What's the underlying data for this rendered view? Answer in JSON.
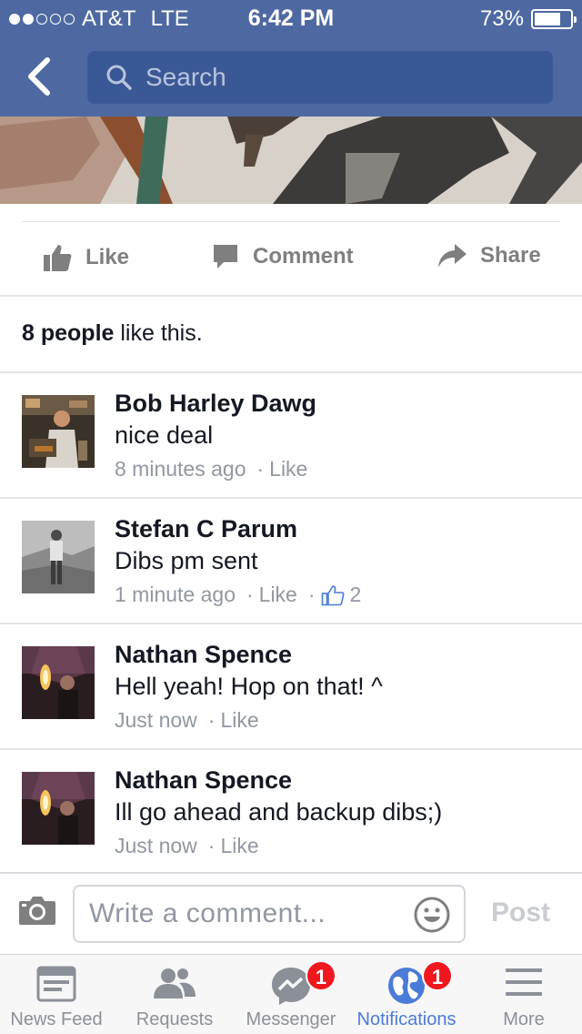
{
  "status_bar": {
    "carrier": "AT&T",
    "network": "LTE",
    "time": "6:42 PM",
    "battery_percent": "73%",
    "battery_level": 0.73,
    "signal_bars": 2
  },
  "nav": {
    "search_placeholder": "Search"
  },
  "actions": {
    "like": "Like",
    "comment": "Comment",
    "share": "Share"
  },
  "likes": {
    "count": "8 people",
    "suffix": " like this."
  },
  "comments": [
    {
      "name": "Bob Harley Dawg",
      "text": "nice deal",
      "time": "8 minutes ago",
      "like": "Like",
      "likes_count": ""
    },
    {
      "name": "Stefan C Parum",
      "text": "Dibs pm sent",
      "time": "1 minute ago",
      "like": "Like",
      "likes_count": "2"
    },
    {
      "name": "Nathan Spence",
      "text": "Hell yeah! Hop on that! ^",
      "time": "Just now",
      "like": "Like",
      "likes_count": ""
    },
    {
      "name": "Nathan Spence",
      "text": "Ill go ahead and backup dibs;)",
      "time": "Just now",
      "like": "Like",
      "likes_count": ""
    }
  ],
  "composer": {
    "placeholder": "Write a comment...",
    "post": "Post"
  },
  "tabs": [
    {
      "label": "News Feed",
      "icon": "news-feed-icon",
      "badge": ""
    },
    {
      "label": "Requests",
      "icon": "friend-requests-icon",
      "badge": ""
    },
    {
      "label": "Messenger",
      "icon": "messenger-icon",
      "badge": "1"
    },
    {
      "label": "Notifications",
      "icon": "globe-icon",
      "badge": "1",
      "active": true
    },
    {
      "label": "More",
      "icon": "menu-icon",
      "badge": ""
    }
  ],
  "colors": {
    "brand_blue": "#4e69a2",
    "active_tab": "#4b7bd8",
    "badge_red": "#f0171f",
    "meta_gray": "#9197a3"
  }
}
